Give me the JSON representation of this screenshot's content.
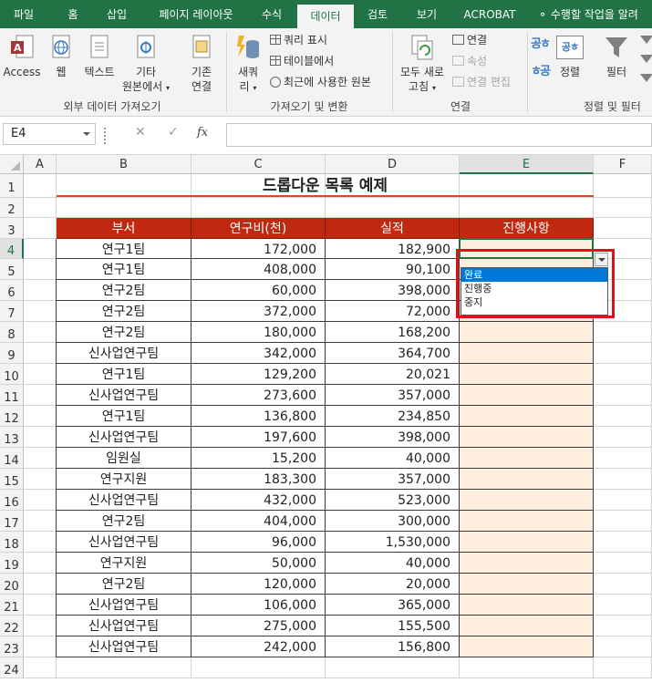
{
  "ribbon_tabs": [
    "파일",
    "홈",
    "삽입",
    "페이지 레이아웃",
    "수식",
    "데이터",
    "검토",
    "보기",
    "ACROBAT"
  ],
  "active_tab": "데이터",
  "tell_me": "수행할 작업을 알려",
  "ribbon": {
    "access": "Access",
    "web": "웹",
    "text": "텍스트",
    "other_line1": "기타",
    "other_line2": "원본에서",
    "existing_line1": "기존",
    "existing_line2": "연결",
    "group_external": "외부 데이터 가져오기",
    "new_query_line1": "새쿼",
    "new_query_line2": "리",
    "show_queries": "쿼리 표시",
    "from_table": "테이블에서",
    "recent_sources": "최근에 사용한 원본",
    "group_get_transform": "가져오기 및 변환",
    "refresh_line1": "모두 새로",
    "refresh_line2": "고침",
    "connections": "연결",
    "properties": "속성",
    "edit_links": "연결 편집",
    "group_connections": "연결",
    "sort": "정렬",
    "filter": "필터",
    "group_sort_filter": "정렬 및 필터",
    "sort_az_icon": "공ㅎ",
    "sort_za_icon": "ㅎ공"
  },
  "name_box": "E4",
  "formula_bar": {
    "cancel_icon": "✕",
    "enter_icon": "✓",
    "fx": "fx",
    "value": ""
  },
  "columns": [
    "A",
    "B",
    "C",
    "D",
    "E",
    "F"
  ],
  "rows": [
    "1",
    "2",
    "3",
    "4",
    "5",
    "6",
    "7",
    "8",
    "9",
    "10",
    "11",
    "12",
    "13",
    "14",
    "15",
    "16",
    "17",
    "18",
    "19",
    "20",
    "21",
    "22",
    "23",
    "24"
  ],
  "sheet": {
    "title": "드롭다운 목록 예제",
    "headers": [
      "부서",
      "연구비(천)",
      "실적",
      "진행사항"
    ],
    "data": [
      [
        "연구1팀",
        "172,000",
        "182,900",
        ""
      ],
      [
        "연구1팀",
        "408,000",
        "90,100",
        ""
      ],
      [
        "연구2팀",
        "60,000",
        "398,000",
        ""
      ],
      [
        "연구2팀",
        "372,000",
        "72,000",
        ""
      ],
      [
        "연구2팀",
        "180,000",
        "168,200",
        ""
      ],
      [
        "신사업연구팀",
        "342,000",
        "364,700",
        ""
      ],
      [
        "연구1팀",
        "129,200",
        "20,021",
        ""
      ],
      [
        "신사업연구팀",
        "273,600",
        "357,000",
        ""
      ],
      [
        "연구1팀",
        "136,800",
        "234,850",
        ""
      ],
      [
        "신사업연구팀",
        "197,600",
        "398,000",
        ""
      ],
      [
        "임원실",
        "15,200",
        "40,000",
        ""
      ],
      [
        "연구지원",
        "183,300",
        "357,000",
        ""
      ],
      [
        "신사업연구팀",
        "432,000",
        "523,000",
        ""
      ],
      [
        "연구2팀",
        "404,000",
        "300,000",
        ""
      ],
      [
        "신사업연구팀",
        "96,000",
        "1,530,000",
        ""
      ],
      [
        "연구지원",
        "50,000",
        "40,000",
        ""
      ],
      [
        "연구2팀",
        "120,000",
        "20,000",
        ""
      ],
      [
        "신사업연구팀",
        "106,000",
        "365,000",
        ""
      ],
      [
        "신사업연구팀",
        "275,000",
        "155,500",
        ""
      ],
      [
        "신사업연구팀",
        "242,000",
        "156,800",
        ""
      ]
    ]
  },
  "dropdown": {
    "options": [
      "완료",
      "진행중",
      "중지"
    ],
    "highlighted": "완료"
  },
  "colors": {
    "excel_green": "#217346",
    "header_red": "#c0280f",
    "status_fill": "#fdeee0",
    "highlight_blue": "#0078d7",
    "callout_red": "#e0101a"
  }
}
